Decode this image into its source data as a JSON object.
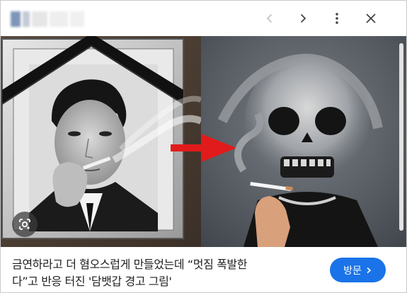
{
  "toolbar": {
    "icons": [
      "chevron-left-icon",
      "chevron-right-icon",
      "more-vert-icon",
      "close-icon"
    ]
  },
  "image": {
    "lens_icon": "google-lens-icon",
    "colors": {
      "arrow": "#e11b1b",
      "frame_ribbon": "#1a1a1a"
    }
  },
  "caption": {
    "line1": "금연하라고 더 혐오스럽게 만들었는데 “멋짐 폭발한",
    "line2": "다”고 반응 터진 '담뱃갑 경고 그림'"
  },
  "visit_button": {
    "label": "방문",
    "icon": "chevron-right-icon",
    "color": "#1a73e8"
  }
}
